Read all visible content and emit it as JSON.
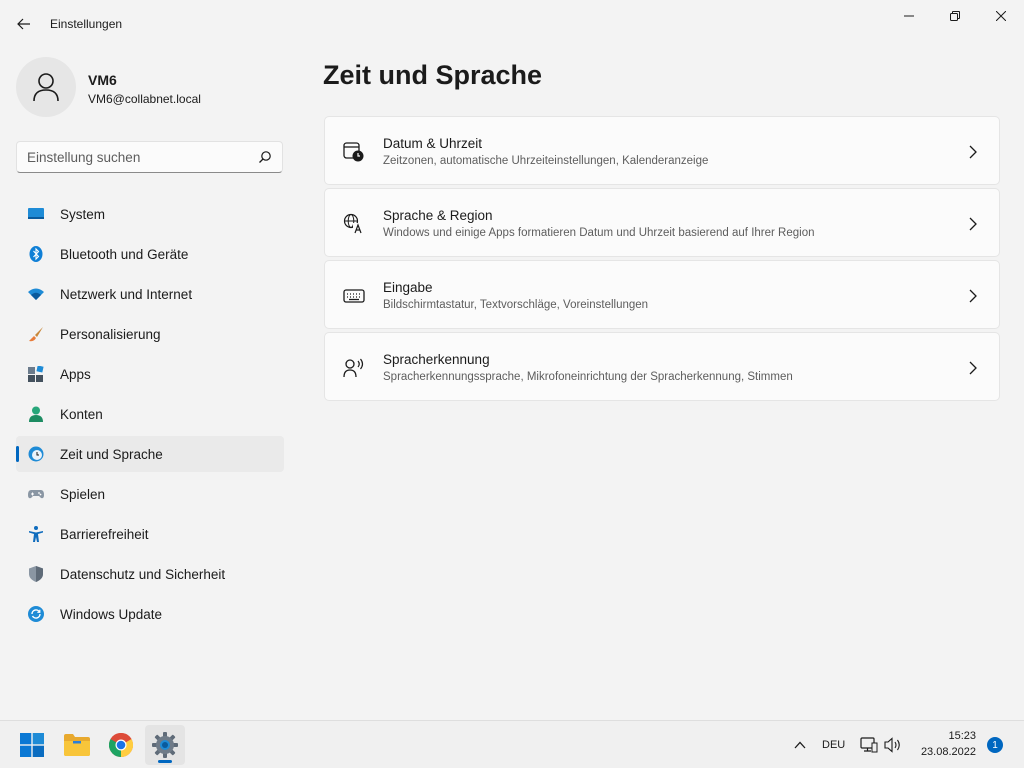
{
  "window": {
    "title": "Einstellungen"
  },
  "user": {
    "name": "VM6",
    "email": "VM6@collabnet.local"
  },
  "search": {
    "placeholder": "Einstellung suchen",
    "value": ""
  },
  "sidebar": {
    "items": [
      {
        "label": "System",
        "icon": "system-icon"
      },
      {
        "label": "Bluetooth und Geräte",
        "icon": "bluetooth-icon"
      },
      {
        "label": "Netzwerk und Internet",
        "icon": "wifi-icon"
      },
      {
        "label": "Personalisierung",
        "icon": "brush-icon"
      },
      {
        "label": "Apps",
        "icon": "apps-icon"
      },
      {
        "label": "Konten",
        "icon": "account-icon"
      },
      {
        "label": "Zeit und Sprache",
        "icon": "time-language-icon",
        "active": true
      },
      {
        "label": "Spielen",
        "icon": "gamepad-icon"
      },
      {
        "label": "Barrierefreiheit",
        "icon": "accessibility-icon"
      },
      {
        "label": "Datenschutz und Sicherheit",
        "icon": "shield-icon"
      },
      {
        "label": "Windows Update",
        "icon": "update-icon"
      }
    ]
  },
  "main": {
    "title": "Zeit und Sprache",
    "cards": [
      {
        "title": "Datum & Uhrzeit",
        "description": "Zeitzonen, automatische Uhrzeiteinstellungen, Kalenderanzeige",
        "icon": "calendar-clock-icon"
      },
      {
        "title": "Sprache & Region",
        "description": "Windows und einige Apps formatieren Datum und Uhrzeit basierend auf Ihrer Region",
        "icon": "language-icon"
      },
      {
        "title": "Eingabe",
        "description": "Bildschirmtastatur, Textvorschläge, Voreinstellungen",
        "icon": "keyboard-icon"
      },
      {
        "title": "Spracherkennung",
        "description": "Spracherkennungssprache, Mikrofoneinrichtung der Spracherkennung, Stimmen",
        "icon": "speech-icon"
      }
    ]
  },
  "taskbar": {
    "apps": [
      "start-icon",
      "file-explorer-icon",
      "chrome-icon",
      "settings-icon"
    ],
    "language": "DEU",
    "time": "15:23",
    "date": "23.08.2022",
    "notification_count": "1"
  },
  "colors": {
    "accent": "#0067c0",
    "background": "#f3f3f3",
    "card": "#fbfbfb"
  }
}
